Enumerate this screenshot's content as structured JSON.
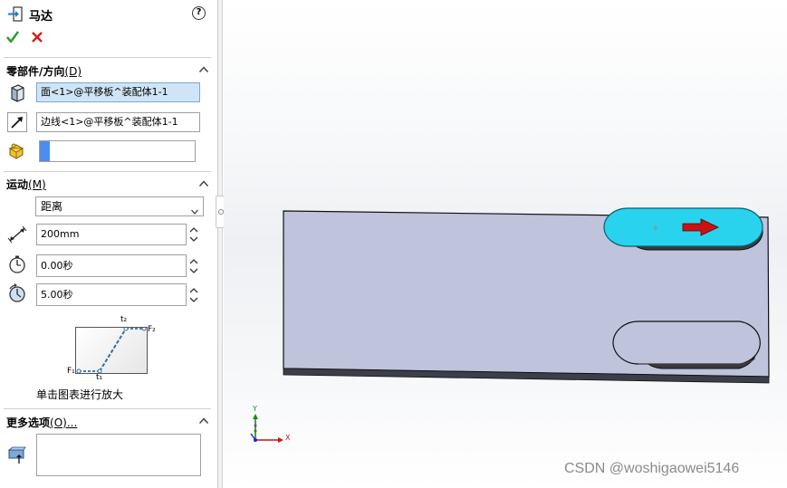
{
  "feature": {
    "title": "马达"
  },
  "component_direction": {
    "header": "零部件/方向",
    "mnemonic": "(D)",
    "face_field": "面<1>@平移板^装配体1-1",
    "edge_field": "边线<1>@平移板^装配体1-1",
    "component_field": ""
  },
  "motion": {
    "header": "运动",
    "mnemonic": "(M)",
    "type_selected": "距离",
    "distance": "200mm",
    "start_time": "0.00秒",
    "duration": "5.00秒",
    "chart_labels": {
      "t2": "t₂",
      "f2": "F₂",
      "f1": "F₁",
      "t1": "t₁"
    },
    "chart_caption": "单击图表进行放大"
  },
  "more_options": {
    "header": "更多选项",
    "mnemonic": "(O)..."
  },
  "viewport": {
    "triad": {
      "x": "X",
      "y": "Y"
    },
    "watermark": "CSDN @woshigaowei5146",
    "colors": {
      "plate": "#c0c3dc",
      "selected_face": "#29d3ee",
      "arrow": "#cc1111"
    }
  },
  "icons": [
    "motor-icon",
    "help-icon",
    "ok-check-icon",
    "cancel-x-icon",
    "face-icon",
    "edge-arrow-icon",
    "component-icon",
    "distance-icon",
    "start-time-icon",
    "duration-icon",
    "list-icon",
    "triad-icon"
  ]
}
